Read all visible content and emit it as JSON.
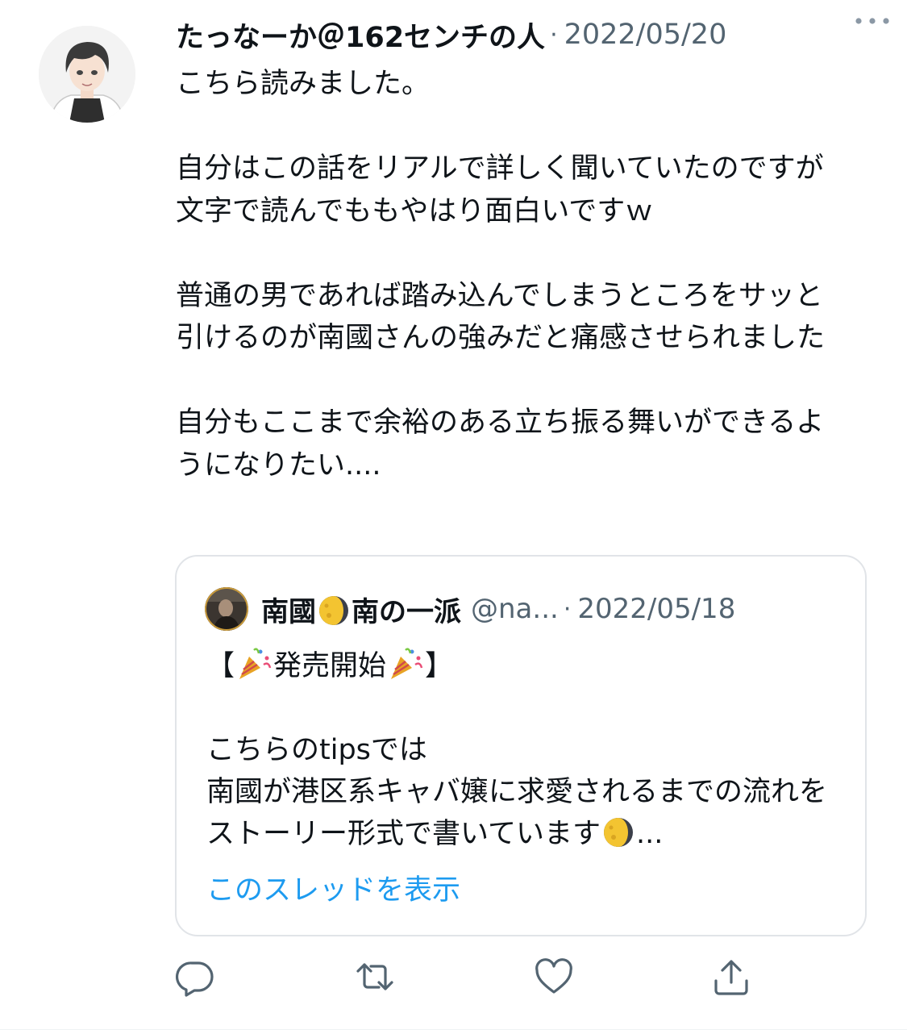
{
  "tweet": {
    "author_name": "たっなーか＠162センチの人",
    "separator": "·",
    "date": "2022/05/20",
    "paragraphs": [
      "こちら読みました。",
      "自分はこの話をリアルで詳しく聞いていたのですが文字で読んでももやはり面白いですｗ",
      "普通の男であれば踏み込んでしまうところをサッと引けるのが南國さんの強みだと痛感させられました",
      "自分もここまで余裕のある立ち振る舞いができるようになりたい...."
    ]
  },
  "quoted_tweet": {
    "name_part1": "南國",
    "name_part2": "南の一派",
    "handle": "@na...",
    "separator": "·",
    "date": "2022/05/18",
    "line1_open": "【",
    "line1_text": "発売開始",
    "line1_close": "】",
    "body_line1": "こちらのtipsでは",
    "body_line2": "南國が港区系キャバ嬢に求愛されるまでの流れをストーリー形式で書いています",
    "body_ellipsis": "...",
    "show_thread": "このスレッドを表示"
  },
  "icons": {
    "more": "more-icon",
    "reply": "reply-icon",
    "retweet": "retweet-icon",
    "like": "like-icon",
    "share": "share-icon"
  },
  "colors": {
    "text": "#0f1419",
    "secondary": "#536471",
    "link": "#1d9bf0",
    "border": "#e1e4e8"
  }
}
